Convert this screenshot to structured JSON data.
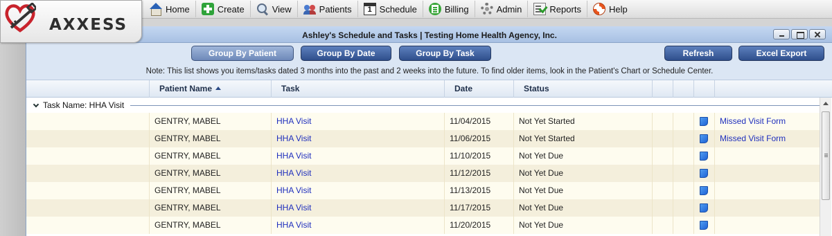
{
  "brand": {
    "logo_text": "AXXESS"
  },
  "menu": [
    {
      "label": "Home",
      "icon": "home-icon"
    },
    {
      "label": "Create",
      "icon": "plus-icon"
    },
    {
      "label": "View",
      "icon": "magnifier-icon"
    },
    {
      "label": "Patients",
      "icon": "people-icon"
    },
    {
      "label": "Schedule",
      "icon": "calendar-icon"
    },
    {
      "label": "Billing",
      "icon": "billing-icon"
    },
    {
      "label": "Admin",
      "icon": "gear-icon"
    },
    {
      "label": "Reports",
      "icon": "report-icon"
    },
    {
      "label": "Help",
      "icon": "lifebuoy-icon"
    }
  ],
  "window": {
    "title": "Ashley's Schedule and Tasks | Testing Home Health Agency, Inc."
  },
  "toolbar": {
    "group_by_patient": "Group By Patient",
    "group_by_date": "Group By Date",
    "group_by_task": "Group By Task",
    "refresh": "Refresh",
    "excel_export": "Excel Export",
    "active_grouping": "Group By Patient",
    "note": "Note: This list shows you items/tasks dated 3 months into the past and 2 weeks into the future. To find older items, look in the Patient's Chart or Schedule Center."
  },
  "grid": {
    "columns": [
      "Patient Name",
      "Task",
      "Date",
      "Status"
    ],
    "sorted_column": "Patient Name",
    "sort_direction": "ascending",
    "group_label": "Task Name: HHA Visit",
    "rows": [
      {
        "patient": "GENTRY, MABEL",
        "task": "HHA Visit",
        "date": "11/04/2015",
        "status": "Not Yet Started",
        "action": "Missed Visit Form"
      },
      {
        "patient": "GENTRY, MABEL",
        "task": "HHA Visit",
        "date": "11/06/2015",
        "status": "Not Yet Started",
        "action": "Missed Visit Form"
      },
      {
        "patient": "GENTRY, MABEL",
        "task": "HHA Visit",
        "date": "11/10/2015",
        "status": "Not Yet Due",
        "action": ""
      },
      {
        "patient": "GENTRY, MABEL",
        "task": "HHA Visit",
        "date": "11/12/2015",
        "status": "Not Yet Due",
        "action": ""
      },
      {
        "patient": "GENTRY, MABEL",
        "task": "HHA Visit",
        "date": "11/13/2015",
        "status": "Not Yet Due",
        "action": ""
      },
      {
        "patient": "GENTRY, MABEL",
        "task": "HHA Visit",
        "date": "11/17/2015",
        "status": "Not Yet Due",
        "action": ""
      },
      {
        "patient": "GENTRY, MABEL",
        "task": "HHA Visit",
        "date": "11/20/2015",
        "status": "Not Yet Due",
        "action": ""
      }
    ]
  },
  "colors": {
    "button_primary": "#2f4f8c",
    "button_active": "#6e89b9",
    "toolbar_bg": "#dbe6f4",
    "link": "#1f2fbd",
    "row_odd": "#fefcef",
    "row_even": "#f4efdc"
  }
}
